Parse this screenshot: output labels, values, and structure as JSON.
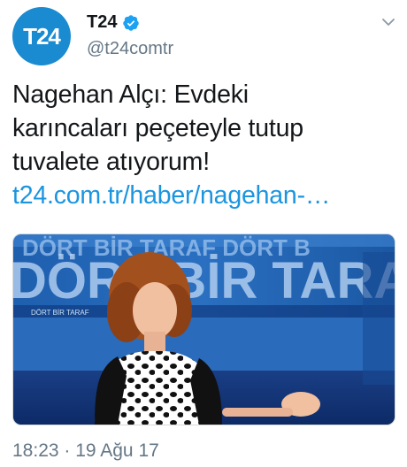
{
  "account": {
    "avatar_text": "T24",
    "display_name": "T24",
    "handle": "@t24comtr",
    "verified": true
  },
  "tweet": {
    "text_lines": [
      "Nagehan Alçı: Evdeki",
      "karıncaları peçeteyle tutup",
      "tuvalete atıyorum!"
    ],
    "link": "t24.com.tr/haber/nagehan-…",
    "media": {
      "backdrop_text_top": "DÖRT BİR TARAF   DÖRT B",
      "backdrop_text_big": "DÖRT BİR TARA",
      "backdrop_small": "DÖRT BİR TARAF"
    },
    "timestamp": "18:23 · 19 Ağu 17"
  },
  "colors": {
    "brand_blue": "#1a8bd0",
    "link_blue": "#1b95e0",
    "muted": "#657786"
  },
  "icons": [
    "verified-icon",
    "chevron-down-icon"
  ]
}
